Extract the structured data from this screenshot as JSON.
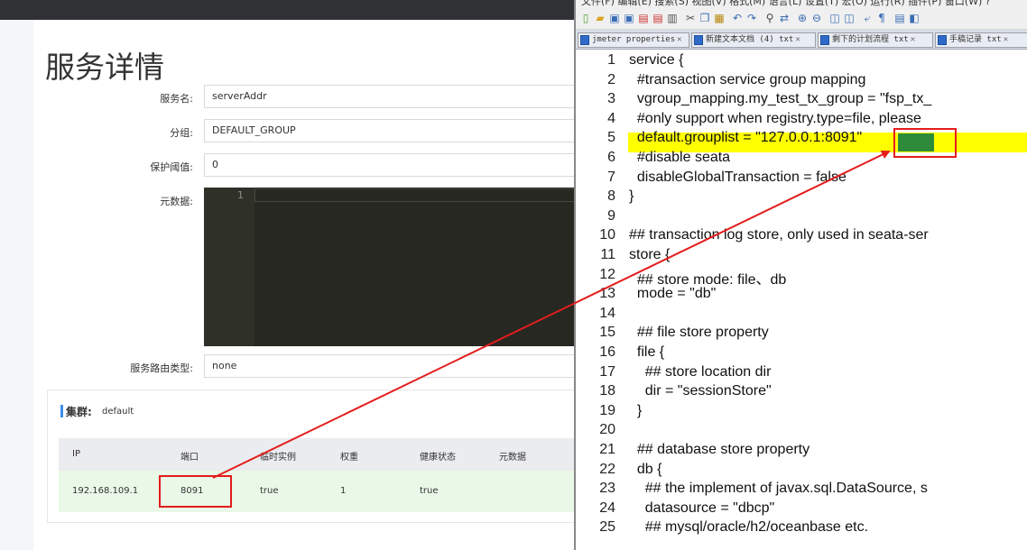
{
  "left_panel": {
    "page_title": "服务详情",
    "fields": [
      {
        "label": "服务名:",
        "value": "serverAddr"
      },
      {
        "label": "分组:",
        "value": "DEFAULT_GROUP"
      },
      {
        "label": "保护阈值:",
        "value": "0"
      },
      {
        "label": "元数据:",
        "editor_line_number": "1"
      },
      {
        "label": "服务路由类型:",
        "value": "none"
      }
    ],
    "cluster": {
      "title": "集群:",
      "name": "default",
      "columns": [
        "IP",
        "端口",
        "临时实例",
        "权重",
        "健康状态",
        "元数据"
      ],
      "rows": [
        {
          "ip": "192.168.109.1",
          "port": "8091",
          "ephemeral": "true",
          "weight": "1",
          "healthy": "true",
          "metadata": ""
        }
      ]
    }
  },
  "right_panel": {
    "menubar": "文件(F)   编辑(E)   搜索(S)   视图(V)   格式(M)   语言(L)   设置(T)   宏(O)   运行(R)   插件(P)   窗口(W)   ?",
    "toolbar_icons": [
      "new-icon",
      "open-icon",
      "save-icon",
      "save-all-icon",
      "close-icon",
      "close-all-icon",
      "print-icon",
      "cut-icon",
      "copy-icon",
      "paste-icon",
      "undo-icon",
      "redo-icon",
      "find-icon",
      "replace-icon",
      "zoom-in-icon",
      "zoom-out-icon",
      "sync-v-icon",
      "sync-h-icon",
      "wrap-icon",
      "all-chars-icon",
      "indent-guide-icon",
      "map-icon"
    ],
    "tabs": [
      {
        "label": "jmeter properties",
        "close": "✕"
      },
      {
        "label": "新建文本文档 (4) txt",
        "close": "✕"
      },
      {
        "label": "剩下的计划流程 txt",
        "close": "✕"
      },
      {
        "label": "手稿记录 txt",
        "close": "✕"
      }
    ],
    "code_lines": [
      {
        "n": "1",
        "text": "service {"
      },
      {
        "n": "2",
        "text": "  #transaction service group mapping"
      },
      {
        "n": "3",
        "text": "  vgroup_mapping.my_test_tx_group = \"fsp_tx_"
      },
      {
        "n": "4",
        "text": "  #only support when registry.type=file, please"
      },
      {
        "n": "5",
        "text": "  default.grouplist = \"127.0.0.1:8091\""
      },
      {
        "n": "6",
        "text": "  #disable seata"
      },
      {
        "n": "7",
        "text": "  disableGlobalTransaction = false"
      },
      {
        "n": "8",
        "text": "}"
      },
      {
        "n": "9",
        "text": ""
      },
      {
        "n": "10",
        "text": "## transaction log store, only used in seata-ser"
      },
      {
        "n": "11",
        "text": "store {"
      },
      {
        "n": "12",
        "text": "  ## store mode: file、db"
      },
      {
        "n": "13",
        "text": "  mode = \"db\""
      },
      {
        "n": "14",
        "text": ""
      },
      {
        "n": "15",
        "text": "  ## file store property"
      },
      {
        "n": "16",
        "text": "  file {"
      },
      {
        "n": "17",
        "text": "    ## store location dir"
      },
      {
        "n": "18",
        "text": "    dir = \"sessionStore\""
      },
      {
        "n": "19",
        "text": "  }"
      },
      {
        "n": "20",
        "text": ""
      },
      {
        "n": "21",
        "text": "  ## database store property"
      },
      {
        "n": "22",
        "text": "  db {"
      },
      {
        "n": "23",
        "text": "    ## the implement of javax.sql.DataSource, s"
      },
      {
        "n": "24",
        "text": "    datasource = \"dbcp\""
      },
      {
        "n": "25",
        "text": "    ## mysql/oracle/h2/oceanbase etc."
      }
    ]
  },
  "colors": {
    "annotation": "#e51c1c",
    "highlight_line": "#ffff00",
    "selection": "#2e8b3a",
    "row_bg": "#e9f8e7",
    "editor_bg": "#272822"
  }
}
